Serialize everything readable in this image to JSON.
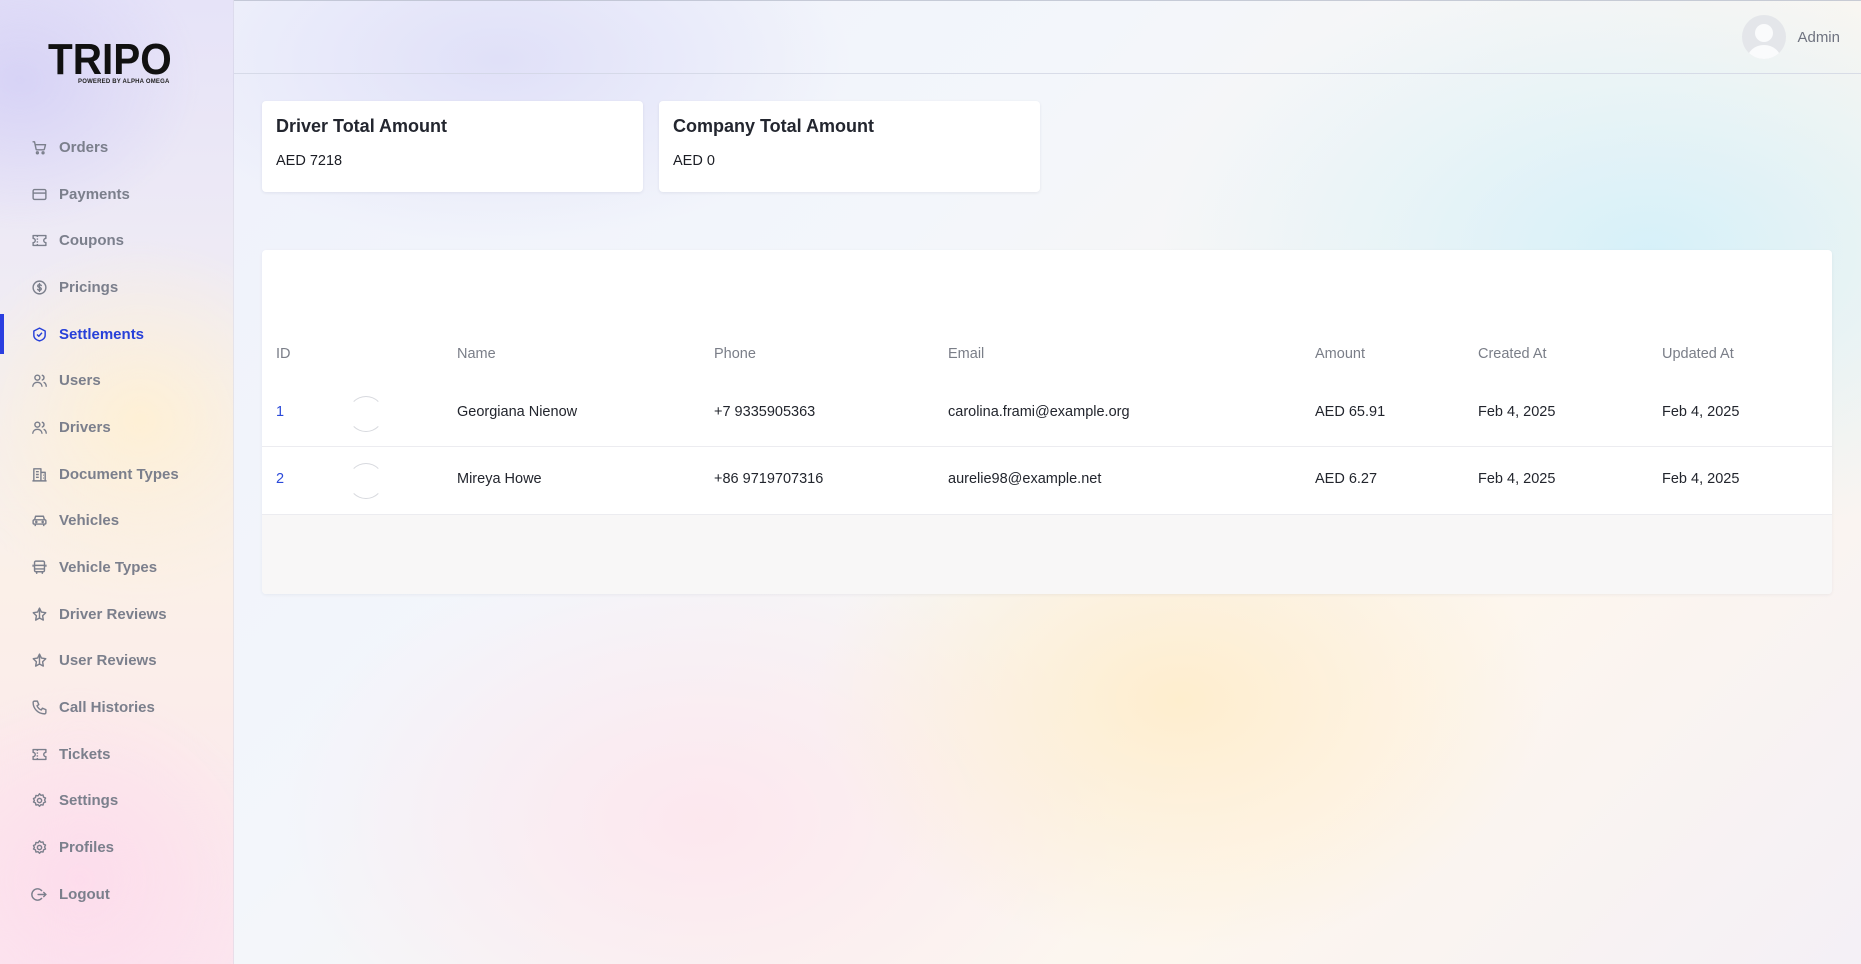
{
  "app": {
    "logo_text": "TRIPO",
    "logo_subtitle": "POWERED BY ALPHA OMEGA"
  },
  "sidebar": {
    "items": [
      {
        "label": "Orders",
        "icon": "cart-icon"
      },
      {
        "label": "Payments",
        "icon": "credit-card-icon"
      },
      {
        "label": "Coupons",
        "icon": "ticket-icon"
      },
      {
        "label": "Pricings",
        "icon": "dollar-circle-icon"
      },
      {
        "label": "Settlements",
        "icon": "handshake-icon",
        "active": true
      },
      {
        "label": "Users",
        "icon": "users-icon"
      },
      {
        "label": "Drivers",
        "icon": "users-icon"
      },
      {
        "label": "Document Types",
        "icon": "document-building-icon"
      },
      {
        "label": "Vehicles",
        "icon": "car-icon"
      },
      {
        "label": "Vehicle Types",
        "icon": "bus-icon"
      },
      {
        "label": "Driver Reviews",
        "icon": "star-icon"
      },
      {
        "label": "User Reviews",
        "icon": "star-icon"
      },
      {
        "label": "Call Histories",
        "icon": "phone-icon"
      },
      {
        "label": "Tickets",
        "icon": "ticket-icon"
      },
      {
        "label": "Settings",
        "icon": "gear-icon"
      },
      {
        "label": "Profiles",
        "icon": "gear-icon"
      },
      {
        "label": "Logout",
        "icon": "logout-icon"
      }
    ]
  },
  "header": {
    "user_name": "Admin"
  },
  "stats": {
    "driver_title": "Driver Total Amount",
    "driver_value": "AED 7218",
    "company_title": "Company Total Amount",
    "company_value": "AED 0"
  },
  "table": {
    "columns": [
      "ID",
      "Name",
      "Phone",
      "Email",
      "Amount",
      "Created At",
      "Updated At"
    ],
    "rows": [
      {
        "id": "1",
        "name": "Georgiana Nienow",
        "phone": "+7 9335905363",
        "email": "carolina.frami@example.org",
        "amount": "AED 65.91",
        "created_at": "Feb 4, 2025",
        "updated_at": "Feb 4, 2025"
      },
      {
        "id": "2",
        "name": "Mireya Howe",
        "phone": "+86 9719707316",
        "email": "aurelie98@example.net",
        "amount": "AED 6.27",
        "created_at": "Feb 4, 2025",
        "updated_at": "Feb 4, 2025"
      }
    ]
  },
  "colors": {
    "accent": "#2740d9",
    "nav_text": "#7b7f8c"
  }
}
